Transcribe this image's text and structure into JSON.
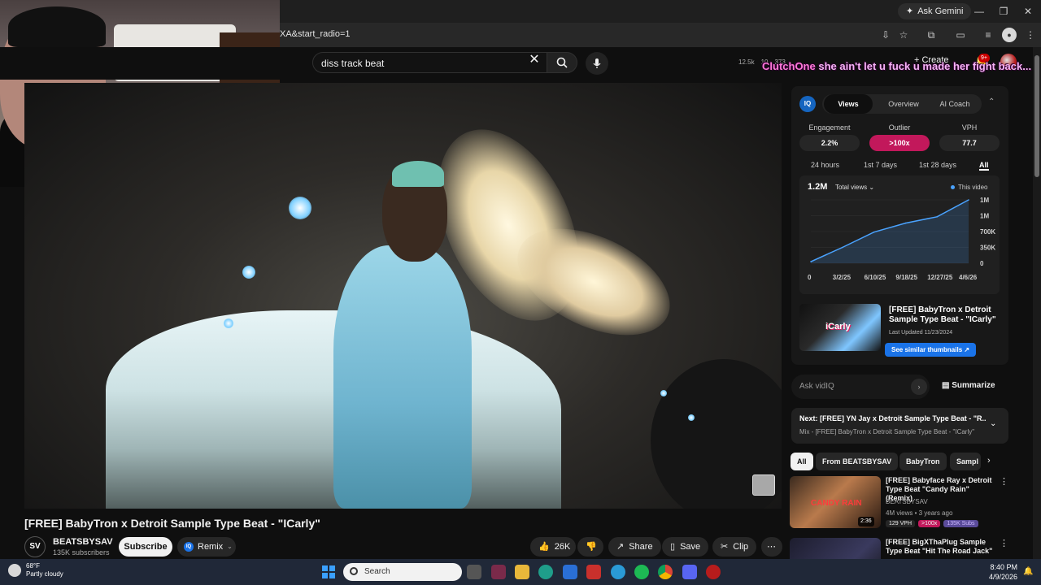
{
  "browser": {
    "ask_gemini": "Ask Gemini",
    "url_fragment": "XA&start_radio=1",
    "window_controls": [
      "minimize-icon",
      "restore-icon",
      "close-icon"
    ]
  },
  "youtube_header": {
    "search_value": "diss track beat",
    "stats": [
      "12.5k",
      "10",
      "373"
    ],
    "create_label": "Create",
    "notifications_badge": "9+"
  },
  "stream_chat": {
    "user": "ClutchOne",
    "message": "she ain't let u fuck u made her fight back..."
  },
  "video": {
    "title": "[FREE] BabyTron x Detroit Sample Type Beat - \"ICarly\"",
    "channel_initials": "SV",
    "channel_name": "BEATSBYSAV",
    "channel_subs": "135K subscribers",
    "subscribe_label": "Subscribe",
    "remix_label": "Remix",
    "actions": {
      "likes": "26K",
      "share": "Share",
      "save": "Save",
      "clip": "Clip"
    }
  },
  "vidiq": {
    "logo": "IQ",
    "tabs": [
      "Views",
      "Overview",
      "AI Coach"
    ],
    "metrics": [
      {
        "label": "Engagement",
        "value": "2.2%"
      },
      {
        "label": "Outlier",
        "value": ">100x"
      },
      {
        "label": "VPH",
        "value": "77.7"
      }
    ],
    "periods": [
      "24 hours",
      "1st 7 days",
      "1st 28 days",
      "All"
    ],
    "active_period": "All",
    "chart_total": "1.2M",
    "chart_select": "Total views",
    "chart_legend": "This video",
    "thumb_title": "[FREE] BabyTron x Detroit Sample Type Beat - \"ICarly\"",
    "thumb_text": "iCarly",
    "last_updated": "Last Updated 11/23/2024",
    "similar_label": "See similar thumbnails",
    "ask_placeholder": "Ask vidIQ",
    "summarize_label": "Summarize"
  },
  "chart_data": {
    "type": "line",
    "x": [
      "0",
      "3/2/25",
      "6/10/25",
      "9/18/25",
      "12/27/25",
      "4/6/26"
    ],
    "y_ticks": [
      "1M",
      "1M",
      "700K",
      "350K",
      "0"
    ],
    "series": [
      {
        "values": [
          30000,
          300000,
          590000,
          760000,
          880000,
          1200000
        ]
      }
    ],
    "ylim": [
      0,
      1200000
    ],
    "grid": true,
    "legend_position": "top-right"
  },
  "up_next": {
    "title": "Next: [FREE] YN Jay x Detroit Sample Type Beat - \"R...",
    "subtitle": "Mix - [FREE] BabyTron x Detroit Sample Type Beat - \"ICarly\""
  },
  "chips": [
    "All",
    "From BEATSBYSAV",
    "BabyTron",
    "Sampl"
  ],
  "recommendations": [
    {
      "title": "[FREE] Babyface Ray x Detroit Type Beat \"Candy Rain\" (Remix)",
      "channel": "BEATSBYSAV",
      "meta": "4M views • 3 years ago",
      "duration": "2:36",
      "thumb_text": "CANDY RAIN",
      "tags": [
        "129 VPH",
        ">100x",
        "135K Subs"
      ]
    },
    {
      "title": "[FREE] BigXThaPlug Sample Type Beat \"Hit The Road Jack\"",
      "channel": "",
      "meta": "",
      "duration": "",
      "thumb_text": "",
      "tags": []
    }
  ],
  "taskbar": {
    "temp": "68°F",
    "condition": "Partly cloudy",
    "search_label": "Search",
    "time": "8:40 PM",
    "date": "4/9/2026"
  }
}
